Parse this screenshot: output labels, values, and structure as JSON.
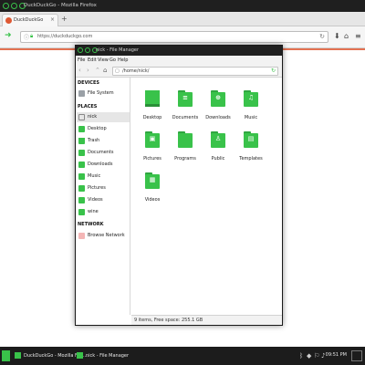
{
  "browser": {
    "title": "DuckDuckGo - Mozilla Firefox",
    "tab_label": "DuckDuckGo",
    "tab_close": "×",
    "new_tab": "+",
    "url": "https://duckduckgo.com",
    "icons": [
      "back-icon",
      "info-icon",
      "lock-icon",
      "reload-icon",
      "download-icon",
      "home-icon",
      "menu-icon"
    ]
  },
  "file_manager": {
    "title": "nick - File Manager",
    "menu": [
      "File",
      "Edit",
      "View",
      "Go",
      "Help"
    ],
    "path": "/home/nick/",
    "sidebar": {
      "devices_heading": "DEVICES",
      "devices": [
        {
          "label": "File System",
          "icon": "drive-icon"
        }
      ],
      "places_heading": "PLACES",
      "places": [
        {
          "label": "nick",
          "icon": "home-icon",
          "selected": true
        },
        {
          "label": "Desktop",
          "icon": "desktop-icon"
        },
        {
          "label": "Trash",
          "icon": "trash-icon"
        },
        {
          "label": "Documents",
          "icon": "folder-icon"
        },
        {
          "label": "Downloads",
          "icon": "folder-icon"
        },
        {
          "label": "Music",
          "icon": "folder-icon"
        },
        {
          "label": "Pictures",
          "icon": "folder-icon"
        },
        {
          "label": "Videos",
          "icon": "folder-icon"
        },
        {
          "label": "wine",
          "icon": "folder-icon"
        }
      ],
      "network_heading": "NETWORK",
      "network": [
        {
          "label": "Browse Network",
          "icon": "network-icon"
        }
      ]
    },
    "items": [
      {
        "label": "Desktop",
        "icon": "desktop-icon"
      },
      {
        "label": "Documents",
        "icon": "documents-folder-icon",
        "glyph": "≡"
      },
      {
        "label": "Downloads",
        "icon": "downloads-folder-icon",
        "glyph": "⊕"
      },
      {
        "label": "Music",
        "icon": "music-folder-icon",
        "glyph": "♫"
      },
      {
        "label": "Pictures",
        "icon": "pictures-folder-icon",
        "glyph": "▣"
      },
      {
        "label": "Programs",
        "icon": "programs-folder-icon",
        "glyph": ""
      },
      {
        "label": "Public",
        "icon": "public-folder-icon",
        "glyph": "♙"
      },
      {
        "label": "Templates",
        "icon": "templates-folder-icon",
        "glyph": "▤"
      },
      {
        "label": "Videos",
        "icon": "videos-folder-icon",
        "glyph": "▦"
      }
    ],
    "status": "9 items, Free space: 255.1 GB"
  },
  "taskbar": {
    "tasks": [
      {
        "label": "DuckDuckGo - Mozilla Fire..."
      },
      {
        "label": "nick - File Manager"
      }
    ],
    "clock": "09:51 PM"
  },
  "colors": {
    "accent": "#39c24a",
    "titlebar": "#1f1f1f",
    "ddg": "#de5833"
  }
}
